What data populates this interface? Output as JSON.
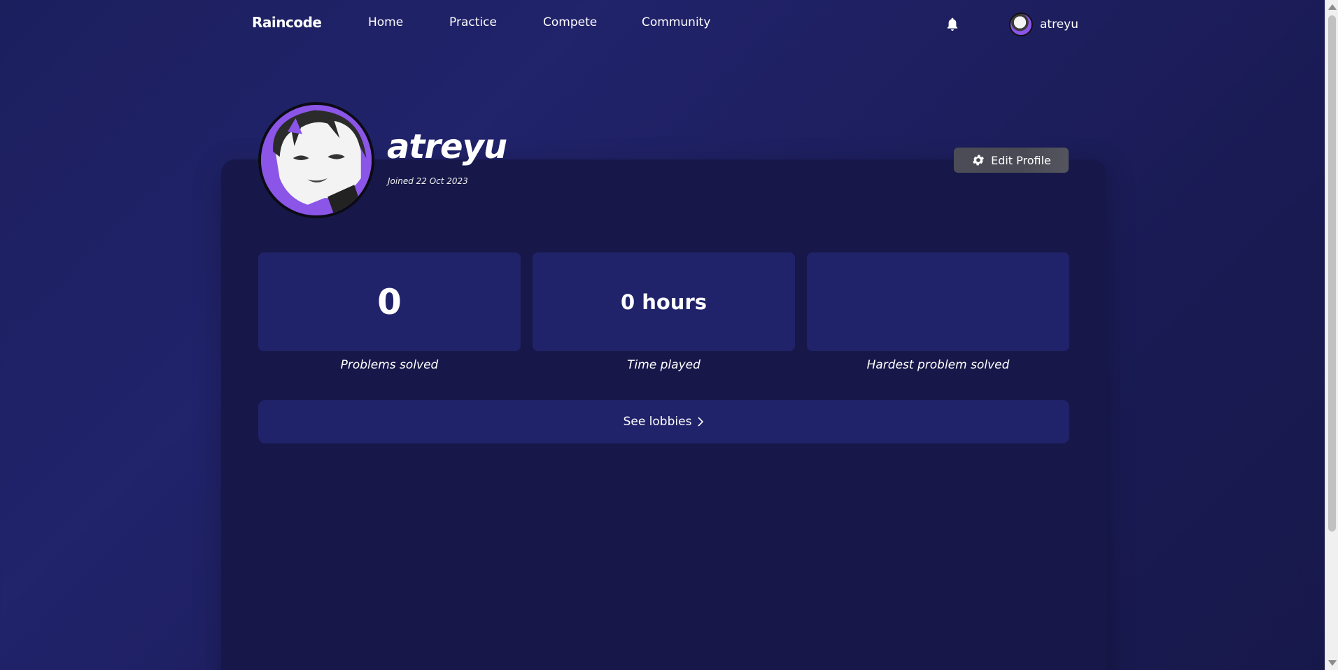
{
  "nav": {
    "brand": "Raincode",
    "links": [
      {
        "label": "Home"
      },
      {
        "label": "Practice"
      },
      {
        "label": "Compete"
      },
      {
        "label": "Community"
      }
    ],
    "notification_icon": "bell-icon",
    "user": {
      "name": "atreyu"
    }
  },
  "profile": {
    "username": "atreyu",
    "joined": "Joined 22 Oct 2023",
    "edit_button": "Edit Profile",
    "edit_icon": "gear-icon"
  },
  "stats": [
    {
      "value": "0",
      "label": "Problems solved"
    },
    {
      "value": "0 hours",
      "label": "Time played"
    },
    {
      "value": "",
      "label": "Hardest problem solved"
    }
  ],
  "lobbies": {
    "label": "See lobbies",
    "icon": "chevron-right-icon"
  },
  "colors": {
    "background": "#1e2063",
    "card": "#171849",
    "stat_box": "#20236a",
    "avatar_accent": "#8b55e8",
    "edit_button": "#4c4c57"
  }
}
